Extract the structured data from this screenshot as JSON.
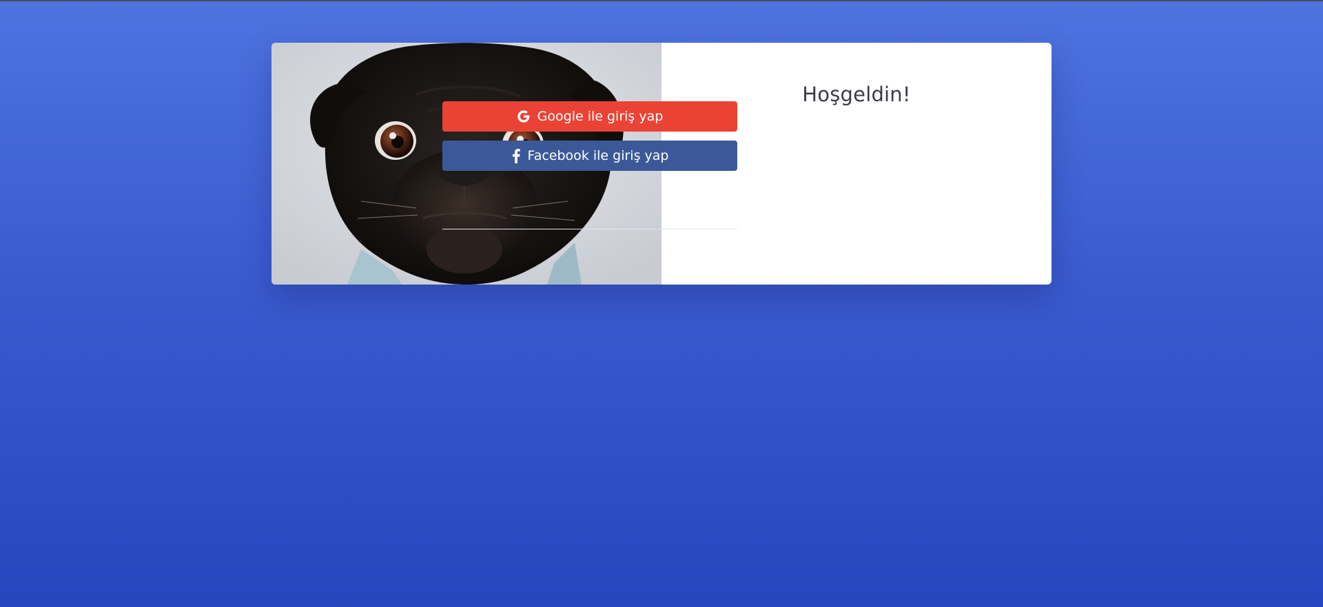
{
  "page": {
    "title": "Hoşgeldin!"
  },
  "image": {
    "subject": "black-pug-dog"
  },
  "buttons": {
    "google": {
      "label": "Google ile giriş yap",
      "icon": "google-icon",
      "color": "#ea4335"
    },
    "facebook": {
      "label": "Facebook ile giriş yap",
      "icon": "facebook-icon",
      "color": "#3b5998"
    }
  },
  "colors": {
    "background_top": "#4e73df",
    "background_bottom": "#2546be",
    "card": "#ffffff",
    "title_text": "#3a3b45"
  }
}
